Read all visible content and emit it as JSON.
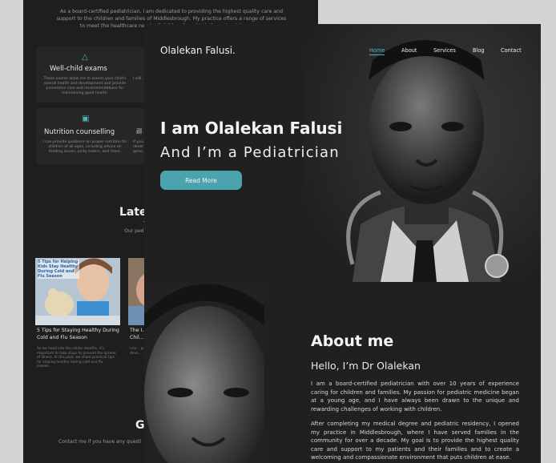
{
  "back_page": {
    "intro": "As a board-certified pediatrician, I am dedicated to providing the highest quality care and support to the children and families of Middlesbrough. My practice offers a range of services to meet the healthcare needs of children from birth through adolescence.",
    "services": [
      {
        "title": "Well-child exams",
        "icon": "child-icon",
        "description": "These exams allow me to assess your child's overall health and development and provide preventive care and recommendations for maintaining good health."
      },
      {
        "title": "Nutrition counselling",
        "icon": "medical-kit-icon",
        "description": "I can provide guidance on proper nutrition for children of all ages, including advice on feeding issues, picky eaters, and more."
      },
      {
        "title": "",
        "icon": "",
        "description": "I will..."
      },
      {
        "title": "ill",
        "icon": "",
        "description": "If you... ... devel... ... gene..."
      }
    ],
    "latest_heading": "Late",
    "latest_sub": "Our pediatric practice is committed to... wide range",
    "posts": [
      {
        "thumb_text": "5 Tips for Helping Kids Stay Healthy During Cold and Flu Season",
        "title": "5 Tips for Staying Healthy During Cold and Flu Season",
        "excerpt": "As we head into the colder months, it's important to take steps to prevent the spread of illness. In this post, we share practical tips for staying healthy during cold and flu season."
      },
      {
        "thumb_text": "",
        "title": "The I... Chil...",
        "excerpt": "Chil... play... deve..."
      }
    ],
    "contact_heading": "G",
    "contact_text": "Contact me if you have any questi"
  },
  "front_page": {
    "logo": "Olalekan Falusi.",
    "nav": [
      {
        "label": "Home",
        "active": true
      },
      {
        "label": "About",
        "active": false
      },
      {
        "label": "Services",
        "active": false
      },
      {
        "label": "Blog",
        "active": false
      },
      {
        "label": "Contact",
        "active": false
      }
    ],
    "hero_title": "I am Olalekan Falusi",
    "hero_subtitle": "And I’m a Pediatrician",
    "hero_button": "Read More",
    "about": {
      "heading": "About me",
      "greeting": "Hello, I’m Dr Olalekan",
      "para1": "I am a board-certified pediatrician with over 10 years of experience caring for children and families. My passion for pediatric medicine began at a young age, and I have always been drawn to the unique and rewarding challenges of working with children.",
      "para2": "After completing my medical degree and pediatric residency, I opened my practice in Middlesbrough, where I have served families in the community for over a decade. My goal is to provide the highest quality care and support to my patients and their families and to create a welcoming and compassionate environment that puts children at ease."
    }
  },
  "colors": {
    "accent": "#4fb3bf",
    "button": "#4aa3ad",
    "background": "#202020",
    "canvas": "#d4d4d4"
  }
}
